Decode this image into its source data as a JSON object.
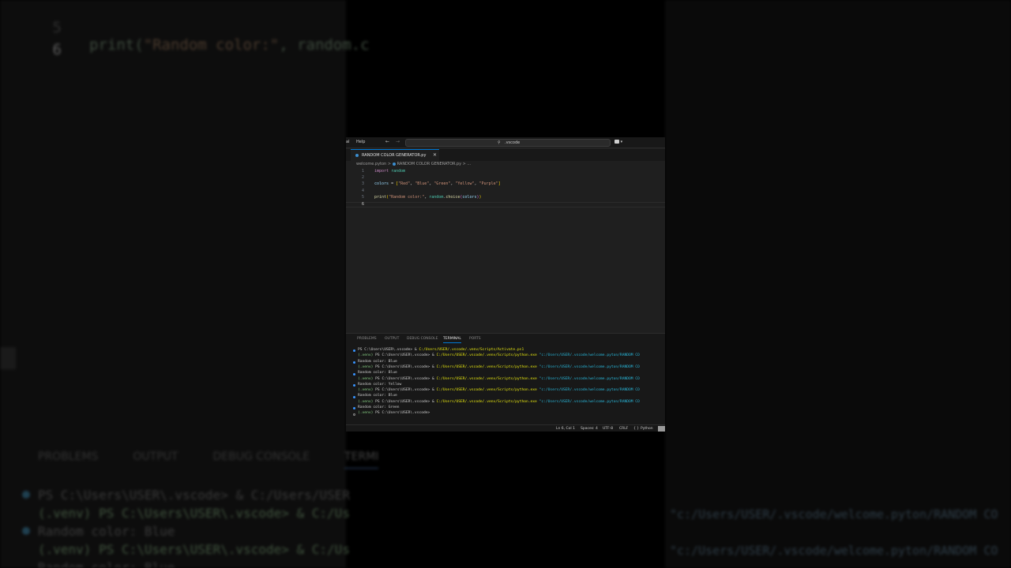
{
  "background_zoom": {
    "code_lines": [
      {
        "num": "5",
        "text_parts": [
          {
            "t": "print(",
            "c": "f"
          },
          {
            "t": "\"Random color:\"",
            "c": "s"
          },
          {
            "t": ", random.c",
            "c": ""
          }
        ]
      },
      {
        "num": "6",
        "text_parts": []
      }
    ],
    "panel_tabs": [
      "PROBLEMS",
      "OUTPUT",
      "DEBUG CONSOLE",
      "TERMI"
    ],
    "terminal_lines": [
      "PS C:\\Users\\USER\\.vscode> & C:/Users/USER",
      "(.venv) PS C:\\Users\\USER\\.vscode> & C:/Us",
      "Random color: Blue",
      "(.venv) PS C:\\Users\\USER\\.vscode> & C:/Us",
      "Random color: Blue"
    ],
    "right_fragments": [
      "\"c:/Users/USER/.vscode/welcome.pyton/RANDOM CO",
      "\"c:/Users/USER/.vscode/welcome.pyton/RANDOM CO"
    ]
  },
  "titlebar": {
    "menu_fragment": "al",
    "help": "Help",
    "nav_back": "←",
    "nav_forward": "→",
    "search_icon": "⚲",
    "search_text": ".vscode",
    "account_caret": "▾"
  },
  "tab": {
    "label": "RANDOM COLOR GENERATOR.py",
    "close": "✕"
  },
  "breadcrumbs": {
    "folder": "welcome.pyton",
    "sep": ">",
    "file": "RANDOM COLOR GENERATOR.py",
    "tail": "> ..."
  },
  "editor": {
    "line_numbers": [
      "1",
      "2",
      "3",
      "4",
      "5",
      "6"
    ],
    "current_line": "6",
    "line1": {
      "kw": "import",
      "mod": "random"
    },
    "line3": {
      "var": "colors",
      "eq": " = ",
      "open": "[",
      "items": [
        "\"Red\"",
        "\"Blue\"",
        "\"Green\"",
        "\"Yellow\"",
        "\"Purple\""
      ],
      "close": "]"
    },
    "line5": {
      "fn": "print",
      "open": "(",
      "str": "\"Random color:\"",
      "comma": ", ",
      "mod": "random",
      "dot": ".",
      "method": "choice",
      "inner_open": "(",
      "arg": "colors",
      "inner_close": ")",
      "close": ")"
    }
  },
  "panel": {
    "tabs": [
      "PROBLEMS",
      "OUTPUT",
      "DEBUG CONSOLE",
      "TERMINAL",
      "PORTS"
    ],
    "active_tab": "TERMINAL"
  },
  "terminal": {
    "lines": [
      {
        "dot": "b",
        "prefix": "",
        "ps": "PS C:\\Users\\USER\\.vscode> & ",
        "path": "C:/Users/USER/.vscode/.venv/Scripts/Activate.ps1",
        "quoted": ""
      },
      {
        "dot": "",
        "prefix": "(.venv) ",
        "ps": "PS C:\\Users\\USER\\.vscode> & ",
        "path": "C:/Users/USER/.vscode/.venv/Scripts/python.exe",
        "quoted": " \"c:/Users/USER/.vscode/welcome.pyton/RANDOM CO"
      },
      {
        "dot": "b",
        "prefix": "",
        "ps": "Random color: Blue",
        "path": "",
        "quoted": ""
      },
      {
        "dot": "",
        "prefix": "(.venv) ",
        "ps": "PS C:\\Users\\USER\\.vscode> & ",
        "path": "C:/Users/USER/.vscode/.venv/Scripts/python.exe",
        "quoted": " \"c:/Users/USER/.vscode/welcome.pyton/RANDOM CO"
      },
      {
        "dot": "b",
        "prefix": "",
        "ps": "Random color: Blue",
        "path": "",
        "quoted": ""
      },
      {
        "dot": "",
        "prefix": "(.venv) ",
        "ps": "PS C:\\Users\\USER\\.vscode> & ",
        "path": "C:/Users/USER/.vscode/.venv/Scripts/python.exe",
        "quoted": " \"c:/Users/USER/.vscode/welcome.pyton/RANDOM CO"
      },
      {
        "dot": "b",
        "prefix": "",
        "ps": "Random color: Yellow",
        "path": "",
        "quoted": ""
      },
      {
        "dot": "",
        "prefix": "(.venv) ",
        "ps": "PS C:\\Users\\USER\\.vscode> & ",
        "path": "C:/Users/USER/.vscode/.venv/Scripts/python.exe",
        "quoted": " \"c:/Users/USER/.vscode/welcome.pyton/RANDOM CO"
      },
      {
        "dot": "b",
        "prefix": "",
        "ps": "Random color: Blue",
        "path": "",
        "quoted": ""
      },
      {
        "dot": "",
        "prefix": "(.venv) ",
        "ps": "PS C:\\Users\\USER\\.vscode> & ",
        "path": "C:/Users/USER/.vscode/.venv/Scripts/python.exe",
        "quoted": " \"c:/Users/USER/.vscode/welcome.pyton/RANDOM CO"
      },
      {
        "dot": "b",
        "prefix": "",
        "ps": "Random color: Green",
        "path": "",
        "quoted": ""
      },
      {
        "dot": "o",
        "prefix": "(.venv) ",
        "ps": "PS C:\\Users\\USER\\.vscode> ",
        "path": "",
        "quoted": ""
      }
    ]
  },
  "statusbar": {
    "position": "Ln 6, Col 1",
    "spaces": "Spaces: 4",
    "encoding": "UTF-8",
    "eol": "CRLF",
    "lang_braces": "{ }",
    "language": "Python"
  }
}
